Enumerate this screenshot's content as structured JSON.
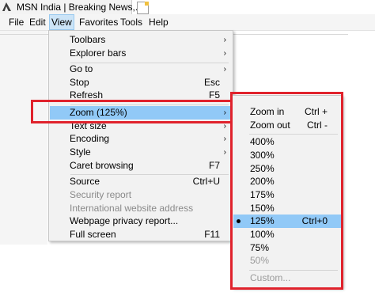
{
  "browser": {
    "tab_title": "MSN India | Breaking News,..."
  },
  "menubar": {
    "items": [
      {
        "label": "File"
      },
      {
        "label": "Edit"
      },
      {
        "label": "View"
      },
      {
        "label": "Favorites"
      },
      {
        "label": "Tools"
      },
      {
        "label": "Help"
      }
    ]
  },
  "view_menu": {
    "items": [
      {
        "label": "Toolbars",
        "shortcut": "",
        "arrow": "›"
      },
      {
        "label": "Explorer bars",
        "shortcut": "",
        "arrow": "›"
      },
      {
        "label": "Go to",
        "shortcut": "",
        "arrow": "›"
      },
      {
        "label": "Stop",
        "shortcut": "Esc",
        "arrow": ""
      },
      {
        "label": "Refresh",
        "shortcut": "F5",
        "arrow": ""
      },
      {
        "label": "Zoom (125%)",
        "shortcut": "",
        "arrow": "›"
      },
      {
        "label": "Text size",
        "shortcut": "",
        "arrow": "›"
      },
      {
        "label": "Encoding",
        "shortcut": "",
        "arrow": "›"
      },
      {
        "label": "Style",
        "shortcut": "",
        "arrow": "›"
      },
      {
        "label": "Caret browsing",
        "shortcut": "F7",
        "arrow": ""
      },
      {
        "label": "Source",
        "shortcut": "Ctrl+U",
        "arrow": ""
      },
      {
        "label": "Security report",
        "shortcut": "",
        "arrow": ""
      },
      {
        "label": "International website address",
        "shortcut": "",
        "arrow": ""
      },
      {
        "label": "Webpage privacy report...",
        "shortcut": "",
        "arrow": ""
      },
      {
        "label": "Full screen",
        "shortcut": "F11",
        "arrow": ""
      }
    ]
  },
  "zoom_menu": {
    "items": [
      {
        "label": "Zoom in",
        "shortcut": "Ctrl +"
      },
      {
        "label": "Zoom out",
        "shortcut": "Ctrl -"
      },
      {
        "label": "400%",
        "shortcut": ""
      },
      {
        "label": "300%",
        "shortcut": ""
      },
      {
        "label": "250%",
        "shortcut": ""
      },
      {
        "label": "200%",
        "shortcut": ""
      },
      {
        "label": "175%",
        "shortcut": ""
      },
      {
        "label": "150%",
        "shortcut": ""
      },
      {
        "label": "125%",
        "shortcut": "Ctrl+0"
      },
      {
        "label": "100%",
        "shortcut": ""
      },
      {
        "label": "75%",
        "shortcut": ""
      },
      {
        "label": "50%",
        "shortcut": ""
      },
      {
        "label": "Custom...",
        "shortcut": ""
      }
    ],
    "selected": "125%"
  },
  "colors": {
    "highlight": "#91c9f7",
    "annotation_red": "#e0222c"
  }
}
